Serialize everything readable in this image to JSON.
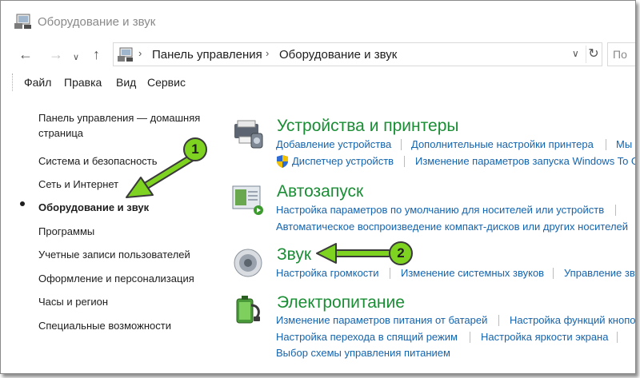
{
  "window": {
    "title": "Оборудование и звук"
  },
  "nav": {
    "breadcrumb": [
      "Панель управления",
      "Оборудование и звук"
    ],
    "search_placeholder": "По"
  },
  "menu": [
    "Файл",
    "Правка",
    "Вид",
    "Сервис"
  ],
  "sidebar": {
    "home": "Панель управления — домашняя страница",
    "items": [
      "Система и безопасность",
      "Сеть и Интернет",
      "Оборудование и звук",
      "Программы",
      "Учетные записи пользователей",
      "Оформление и персонализация",
      "Часы и регион",
      "Специальные возможности"
    ],
    "current_index": 2
  },
  "categories": {
    "devices": {
      "title": "Устройства и принтеры",
      "icon": "printer-icon",
      "links": [
        "Добавление устройства",
        "Дополнительные настройки принтера",
        "Мы",
        "Диспетчер устройств",
        "Изменение параметров запуска Windows To G"
      ]
    },
    "autoplay": {
      "title": "Автозапуск",
      "icon": "autoplay-icon",
      "links": [
        "Настройка параметров по умолчанию для носителей или устройств",
        "Автоматическое воспроизведение компакт-дисков или других носителей"
      ]
    },
    "sound": {
      "title": "Звук",
      "icon": "speaker-icon",
      "links": [
        "Настройка громкости",
        "Изменение системных звуков",
        "Управление звук"
      ]
    },
    "power": {
      "title": "Электропитание",
      "icon": "battery-icon",
      "links": [
        "Изменение параметров питания от батарей",
        "Настройка функций кнопок",
        "Настройка перехода в спящий режим",
        "Настройка яркости экрана",
        "Выбор схемы управления питанием"
      ]
    }
  },
  "annotations": {
    "badge1": "1",
    "badge2": "2",
    "color": "#7ed321"
  }
}
